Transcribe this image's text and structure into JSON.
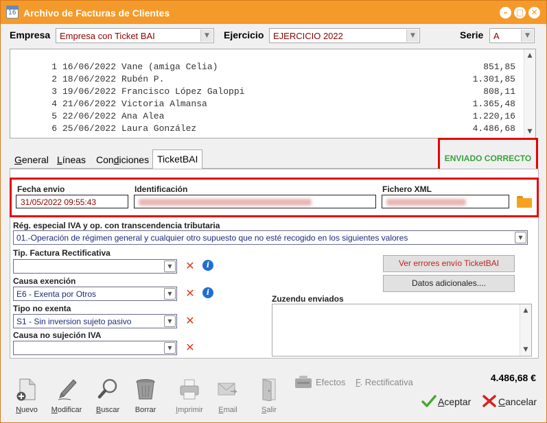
{
  "window": {
    "title": "Archivo de Facturas de Clientes",
    "icon_text": "16",
    "controls": [
      "minimize-icon",
      "maximize-icon",
      "close-icon"
    ]
  },
  "header": {
    "empresa_label": "Empresa",
    "empresa_value": "Empresa con Ticket BAI",
    "ejercicio_label": "Ejercicio",
    "ejercicio_value": "EJERCICIO 2022",
    "serie_label": "Serie",
    "serie_value": "A"
  },
  "invoices": [
    {
      "num": "1",
      "date": "16/06/2022",
      "name": "Vane (amiga Celia)",
      "amount": "851,85"
    },
    {
      "num": "2",
      "date": "18/06/2022",
      "name": "Rubén P.",
      "amount": "1.301,85"
    },
    {
      "num": "3",
      "date": "19/06/2022",
      "name": "Francisco López Galoppi",
      "amount": "808,11"
    },
    {
      "num": "4",
      "date": "21/06/2022",
      "name": "Victoria Almansa",
      "amount": "1.365,48"
    },
    {
      "num": "5",
      "date": "22/06/2022",
      "name": "Ana Alea",
      "amount": "1.220,16"
    },
    {
      "num": "6",
      "date": "25/06/2022",
      "name": "Laura González",
      "amount": "4.486,68"
    }
  ],
  "tabs": [
    {
      "label": "General",
      "u": "G",
      "rest": "eneral"
    },
    {
      "label": "Líneas",
      "u": "L",
      "rest": "íneas"
    },
    {
      "label": "Condiciones",
      "pre": "Con",
      "u": "d",
      "rest": "iciones"
    },
    {
      "label": "TicketBAI",
      "active": true
    }
  ],
  "status": "ENVIADO CORRECTO",
  "ticketbai": {
    "fecha_label": "Fecha envio",
    "fecha_value": "31/05/2022 09:55:43",
    "identificacion_label": "Identificación",
    "fichero_label": "Fichero XML",
    "regimen_label": "Rég. especial IVA y op. con transcendencia tributaria",
    "regimen_value": "01.-Operación de régimen general y cualquier otro supuesto que no esté recogido en los siguientes valores",
    "tip_rect_label": "Tip. Factura Rectificativa",
    "tip_rect_value": "",
    "causa_exencion_label": "Causa exención",
    "causa_exencion_value": "E6 - Exenta por Otros",
    "tipo_no_exenta_label": "Tipo no exenta",
    "tipo_no_exenta_value": "S1 - Sin inversion sujeto pasivo",
    "causa_no_sujecion_label": "Causa no sujeción IVA",
    "causa_no_sujecion_value": "",
    "ver_errores_label": "Ver errores envío TicketBAI",
    "datos_adicionales_label": "Datos adicionales....",
    "zuzendu_label": "Zuzendu enviados",
    "zuzendu_value": ""
  },
  "toolbar": {
    "nuevo": {
      "u": "N",
      "rest": "uevo"
    },
    "modificar": {
      "u": "M",
      "rest": "odificar"
    },
    "buscar": {
      "u": "B",
      "rest": "uscar"
    },
    "borrar": {
      "label": "Borrar"
    },
    "imprimir": {
      "u": "I",
      "rest": "mprimir"
    },
    "email": {
      "u": "E",
      "rest": "mail"
    },
    "salir": {
      "u": "S",
      "rest": "alir"
    },
    "efectos": {
      "label": "Efectos"
    },
    "rectificativa": {
      "u": "F",
      "rest": ". Rectificativa"
    }
  },
  "total": "4.486,68 €",
  "actions": {
    "aceptar": {
      "u": "A",
      "rest": "ceptar"
    },
    "cancelar": {
      "u": "C",
      "rest": "ancelar"
    }
  },
  "colors": {
    "titlebar": "#f49a2a",
    "highlight": "#e60000",
    "status_ok": "#3aa13a",
    "value_text": "#8b0000",
    "select_text": "#1c2a7a"
  }
}
